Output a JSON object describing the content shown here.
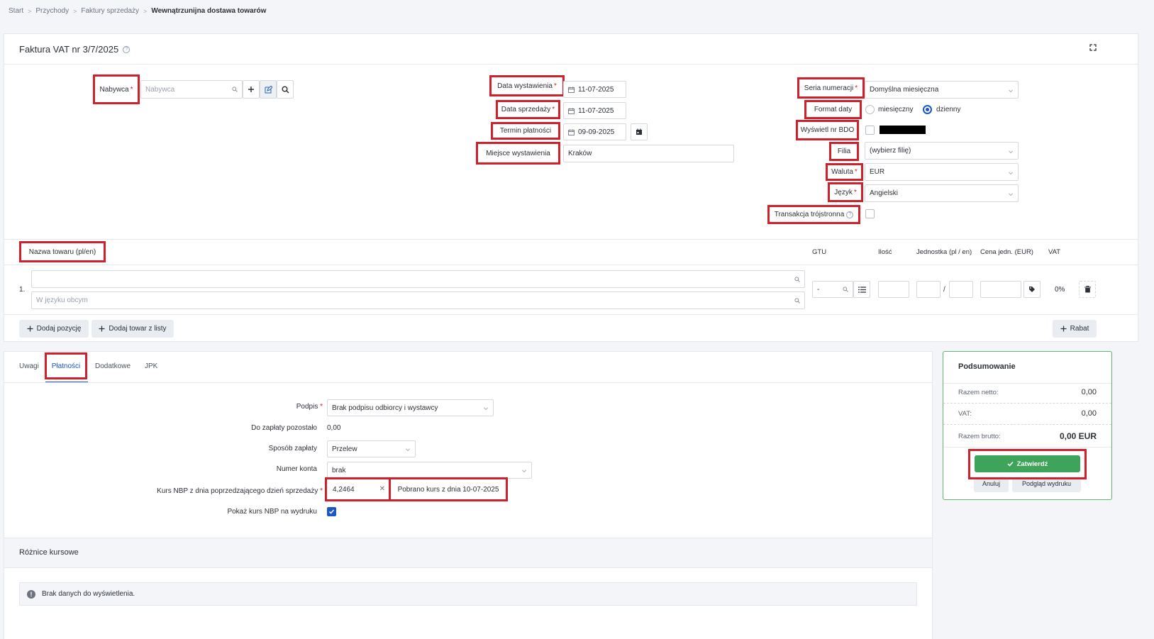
{
  "breadcrumb": [
    "Start",
    "Przychody",
    "Faktury sprzedaży",
    "Wewnątrzunijna dostawa towarów"
  ],
  "invoice": {
    "title": "Faktura VAT nr 3/7/2025",
    "buyer_label": "Nabywca",
    "buyer_placeholder": "Nabywca",
    "issue_date_label": "Data wystawienia",
    "issue_date": "11-07-2025",
    "sale_date_label": "Data sprzedaży",
    "sale_date": "11-07-2025",
    "due_label": "Termin płatności",
    "due_date": "09-09-2025",
    "place_label": "Miejsce wystawienia",
    "place": "Kraków",
    "series_label": "Seria numeracji",
    "series": "Domyślna miesięczna",
    "date_format_label": "Format daty",
    "date_format_monthly": "miesięczny",
    "date_format_daily": "dzienny",
    "bdo_label": "Wyświetl nr BDO",
    "branch_label": "Filia",
    "branch": "(wybierz filię)",
    "currency_label": "Waluta",
    "currency": "EUR",
    "language_label": "Język",
    "language": "Angielski",
    "triangular_label": "Transakcja trójstronna"
  },
  "items_table": {
    "headers": {
      "name": "Nazwa towaru (pl/en)",
      "gtu": "GTU",
      "qty": "Ilość",
      "unit": "Jednostka (pl / en)",
      "price": "Cena jedn. (EUR)",
      "vat": "VAT"
    },
    "row": {
      "index": "1.",
      "foreign_placeholder": "W języku obcym",
      "gtu_value": "-",
      "unit_sep": "/",
      "vat_value": "0%"
    },
    "add_position": "Dodaj pozycję",
    "add_from_list": "Dodaj towar z listy",
    "discount": "Rabat"
  },
  "tabs": [
    "Uwagi",
    "Płatności",
    "Dodatkowe",
    "JPK"
  ],
  "payments": {
    "signature_label": "Podpis",
    "signature": "Brak podpisu odbiorcy i wystawcy",
    "remaining_label": "Do zapłaty pozostało",
    "remaining": "0,00",
    "method_label": "Sposób zapłaty",
    "method": "Przelew",
    "account_label": "Numer konta",
    "account": "brak",
    "rate_label": "Kurs NBP z dnia poprzedzającego dzień sprzedaży",
    "rate": "4,2464",
    "rate_info": "Pobrano kurs z dnia 10-07-2025",
    "show_rate_label": "Pokaż kurs NBP na wydruku"
  },
  "exchange_diff": {
    "title": "Różnice kursowe",
    "empty": "Brak danych do wyświetlenia."
  },
  "summary": {
    "title": "Podsumowanie",
    "net_label": "Razem netto:",
    "net": "0,00",
    "vat_label": "VAT:",
    "vat": "0,00",
    "gross_label": "Razem brutto:",
    "gross": "0,00 EUR",
    "confirm": "Zatwierdź",
    "cancel": "Anuluj",
    "preview": "Podgląd wydruku"
  },
  "colors": {
    "highlight": "#d0202c",
    "primary": "#1b56c9",
    "confirm": "#3ea45a"
  }
}
